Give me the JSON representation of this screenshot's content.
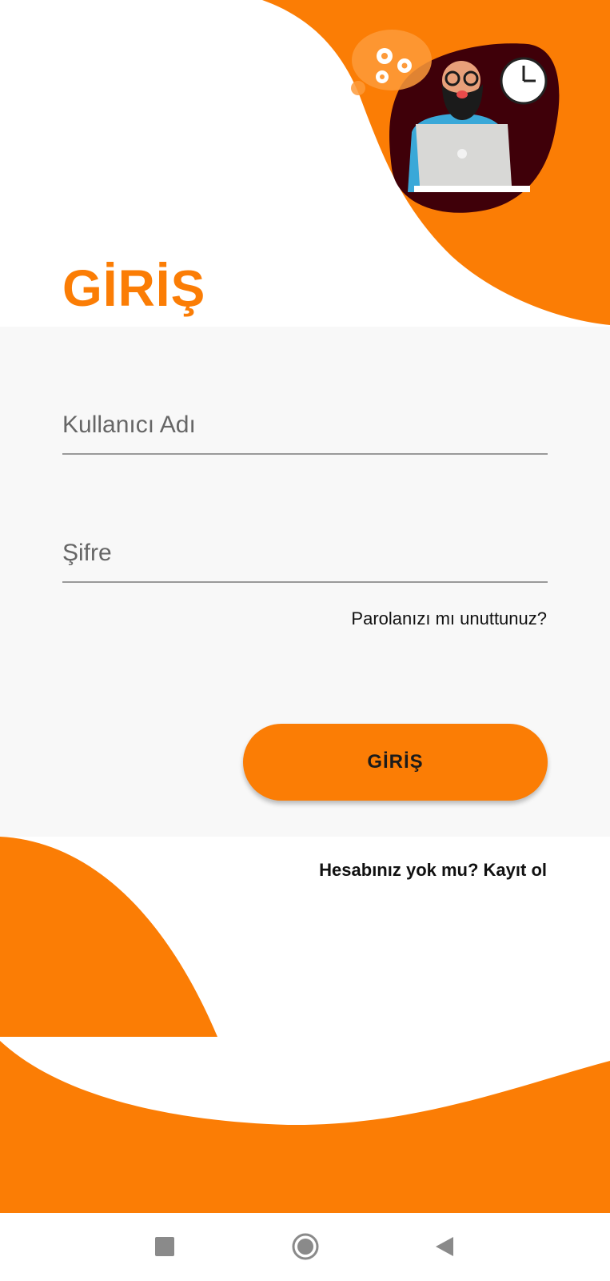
{
  "header": {
    "title": "GİRİŞ"
  },
  "form": {
    "username_placeholder": "Kullanıcı Adı",
    "password_placeholder": "Şifre",
    "forgot_password": "Parolanızı mı unuttunuz?",
    "login_button": "GİRİŞ",
    "register_prompt": "Hesabınız yok mu? Kayıt ol"
  },
  "navigation_bar": {
    "buttons": [
      "recent-apps-icon",
      "home-icon",
      "back-icon"
    ]
  },
  "colors": {
    "accent": "#fb7d05",
    "panel_background": "#f8f8f8",
    "illustration_background": "#3f0009"
  }
}
